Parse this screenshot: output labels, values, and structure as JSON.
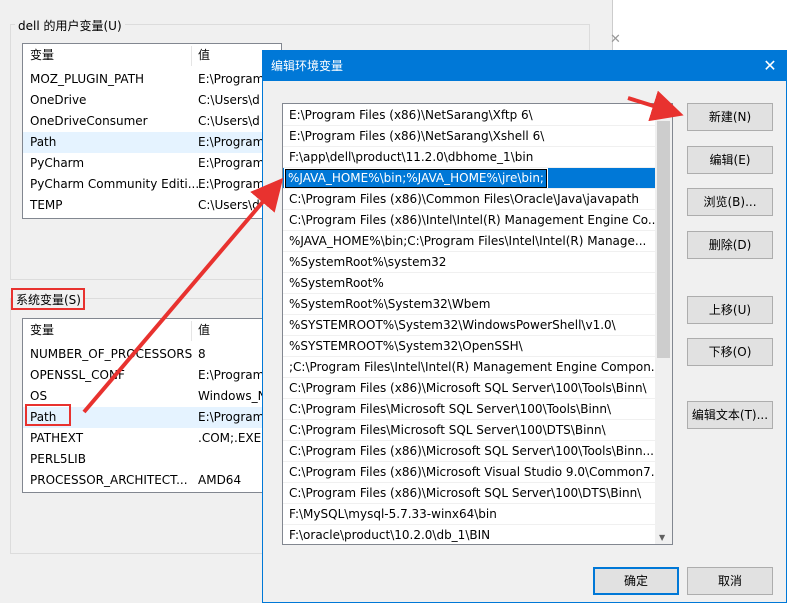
{
  "background_window": {
    "user_group_label": "dell 的用户变量(U)",
    "user_columns": [
      "变量",
      "值"
    ],
    "user_vars": [
      {
        "name": "MOZ_PLUGIN_PATH",
        "value": "E:\\Program"
      },
      {
        "name": "OneDrive",
        "value": "C:\\Users\\d"
      },
      {
        "name": "OneDriveConsumer",
        "value": "C:\\Users\\d"
      },
      {
        "name": "Path",
        "value": "E:\\Program"
      },
      {
        "name": "PyCharm",
        "value": "E:\\Program"
      },
      {
        "name": "PyCharm Community Editi...",
        "value": "E:\\Program"
      },
      {
        "name": "TEMP",
        "value": "C:\\Users\\d"
      }
    ],
    "system_group_label": "系统变量(S)",
    "system_columns": [
      "变量",
      "值"
    ],
    "system_vars": [
      {
        "name": "NUMBER_OF_PROCESSORS",
        "value": "8"
      },
      {
        "name": "OPENSSL_CONF",
        "value": "E:\\Program"
      },
      {
        "name": "OS",
        "value": "Windows_N"
      },
      {
        "name": "Path",
        "value": "E:\\Program"
      },
      {
        "name": "PATHEXT",
        "value": ".COM;.EXE;"
      },
      {
        "name": "PERL5LIB",
        "value": ""
      },
      {
        "name": "PROCESSOR_ARCHITECT...",
        "value": "AMD64"
      }
    ]
  },
  "dialog": {
    "title": "编辑环境变量",
    "paths": [
      "E:\\Program Files (x86)\\NetSarang\\Xftp 6\\",
      "E:\\Program Files (x86)\\NetSarang\\Xshell 6\\",
      "F:\\app\\dell\\product\\11.2.0\\dbhome_1\\bin",
      "%JAVA_HOME%\\bin;%JAVA_HOME%\\jre\\bin;",
      "C:\\Program Files (x86)\\Common Files\\Oracle\\Java\\javapath",
      "C:\\Program Files (x86)\\Intel\\Intel(R) Management Engine Co...",
      "%JAVA_HOME%\\bin;C:\\Program Files\\Intel\\Intel(R) Manage...",
      "%SystemRoot%\\system32",
      "%SystemRoot%",
      "%SystemRoot%\\System32\\Wbem",
      "%SYSTEMROOT%\\System32\\WindowsPowerShell\\v1.0\\",
      "%SYSTEMROOT%\\System32\\OpenSSH\\",
      ";C:\\Program Files\\Intel\\Intel(R) Management Engine Compon...",
      "C:\\Program Files (x86)\\Microsoft SQL Server\\100\\Tools\\Binn\\",
      "C:\\Program Files\\Microsoft SQL Server\\100\\Tools\\Binn\\",
      "C:\\Program Files\\Microsoft SQL Server\\100\\DTS\\Binn\\",
      "C:\\Program Files (x86)\\Microsoft SQL Server\\100\\Tools\\Binn...",
      "C:\\Program Files (x86)\\Microsoft Visual Studio 9.0\\Common7...",
      "C:\\Program Files (x86)\\Microsoft SQL Server\\100\\DTS\\Binn\\",
      "F:\\MySQL\\mysql-5.7.33-winx64\\bin",
      "F:\\oracle\\product\\10.2.0\\db_1\\BIN"
    ],
    "editing_index": 3,
    "buttons": {
      "new": "新建(N)",
      "edit": "编辑(E)",
      "browse": "浏览(B)...",
      "delete": "删除(D)",
      "up": "上移(U)",
      "down": "下移(O)",
      "edit_text": "编辑文本(T)...",
      "ok": "确定",
      "cancel": "取消"
    }
  },
  "annotation_color": "#e8322f",
  "accent_color": "#0078d7"
}
